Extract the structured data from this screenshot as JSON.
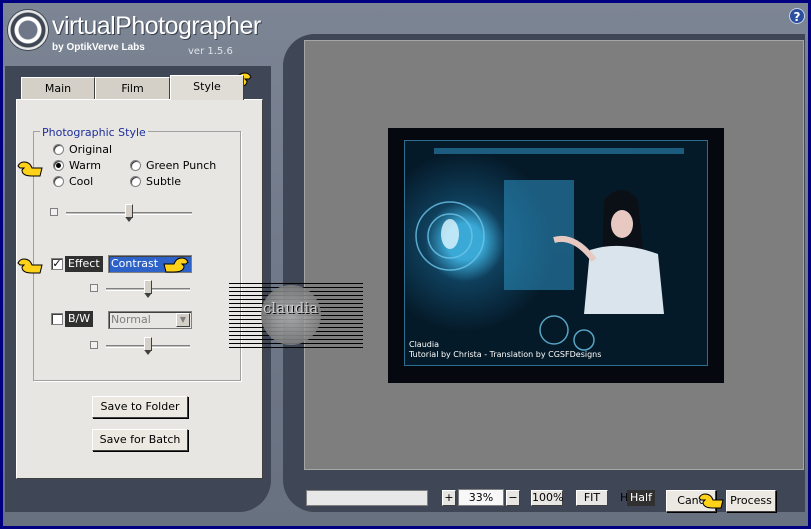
{
  "app": {
    "title": "virtualPhotographer",
    "subtitle": "by OptikVerve Labs",
    "version": "ver 1.5.6",
    "help_icon": "help-icon"
  },
  "tabs": [
    {
      "label": "Main",
      "active": false
    },
    {
      "label": "Film",
      "active": false
    },
    {
      "label": "Style",
      "active": true
    }
  ],
  "style_panel": {
    "group_title": "Photographic Style",
    "radios": [
      {
        "label": "Original",
        "checked": false
      },
      {
        "label": "Warm",
        "checked": true
      },
      {
        "label": "Green Punch",
        "checked": false
      },
      {
        "label": "Cool",
        "checked": false
      },
      {
        "label": "Subtle",
        "checked": false
      }
    ],
    "effect": {
      "label": "Effect",
      "checked": true,
      "value": "Contrast"
    },
    "bw": {
      "label": "B/W",
      "checked": false,
      "value": "Normal"
    },
    "sliders": [
      {
        "name": "style-strength",
        "level": 0.5
      },
      {
        "name": "effect-strength",
        "level": 0.5
      },
      {
        "name": "bw-strength",
        "level": 0.5
      }
    ]
  },
  "buttons": {
    "save_to_folder": "Save to Folder",
    "save_for_batch": "Save for Batch",
    "cancel": "Canc",
    "process": "Process"
  },
  "preview": {
    "caption_name": "Claudia",
    "caption_credit": "Tutorial by Christa - Translation by CGSFDesigns",
    "watermark": "claudia"
  },
  "bottom_bar": {
    "plus": "+",
    "zoom": "33%",
    "minus": "−",
    "hundred": "100%",
    "fit": "FIT",
    "half_prefix": "H",
    "half": "Half"
  },
  "colors": {
    "accent_blue": "#1e2f9a",
    "selection": "#2d63c8",
    "pointer": "#ffd21a"
  }
}
